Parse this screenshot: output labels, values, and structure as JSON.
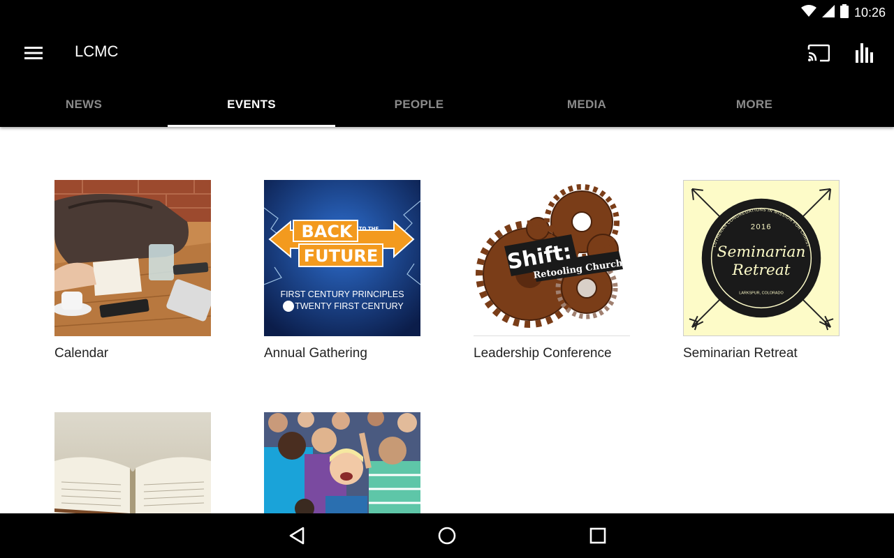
{
  "status_bar": {
    "time": "10:26",
    "icons": [
      "wifi-icon",
      "signal-icon",
      "battery-icon"
    ]
  },
  "app_bar": {
    "title": "LCMC",
    "icons": [
      "menu-icon",
      "cast-icon",
      "bar-chart-icon"
    ]
  },
  "tabs": [
    {
      "label": "NEWS",
      "active": false
    },
    {
      "label": "EVENTS",
      "active": true
    },
    {
      "label": "PEOPLE",
      "active": false
    },
    {
      "label": "MEDIA",
      "active": false
    },
    {
      "label": "MORE",
      "active": false
    }
  ],
  "events": [
    {
      "label": "Calendar"
    },
    {
      "label": "Annual Gathering",
      "art": {
        "line1": "BACK",
        "small": "TO THE",
        "line2": "FUTURE",
        "sub1": "FIRST CENTURY PRINCIPLES",
        "sub2": "TWENTY FIRST CENTURY"
      }
    },
    {
      "label": "Leadership Conference",
      "art": {
        "title": "Shift:",
        "subtitle": "Retooling Church"
      }
    },
    {
      "label": "Seminarian Retreat",
      "art": {
        "year": "2016",
        "line1": "Seminarian",
        "line2": "Retreat",
        "ring_top": "LUTHERAN CONGREGATIONS IN MISSION FOR CHRIST",
        "ring_bottom": "LARKSPUR, COLORADO"
      }
    },
    {
      "label": ""
    },
    {
      "label": ""
    }
  ],
  "colors": {
    "bar_bg": "#000000",
    "tab_inactive": "#8a8a8a",
    "tab_active": "#ffffff",
    "accent_orange": "#f39a1e"
  },
  "nav_bar": {
    "icons": [
      "back-icon",
      "home-icon",
      "recents-icon"
    ]
  }
}
